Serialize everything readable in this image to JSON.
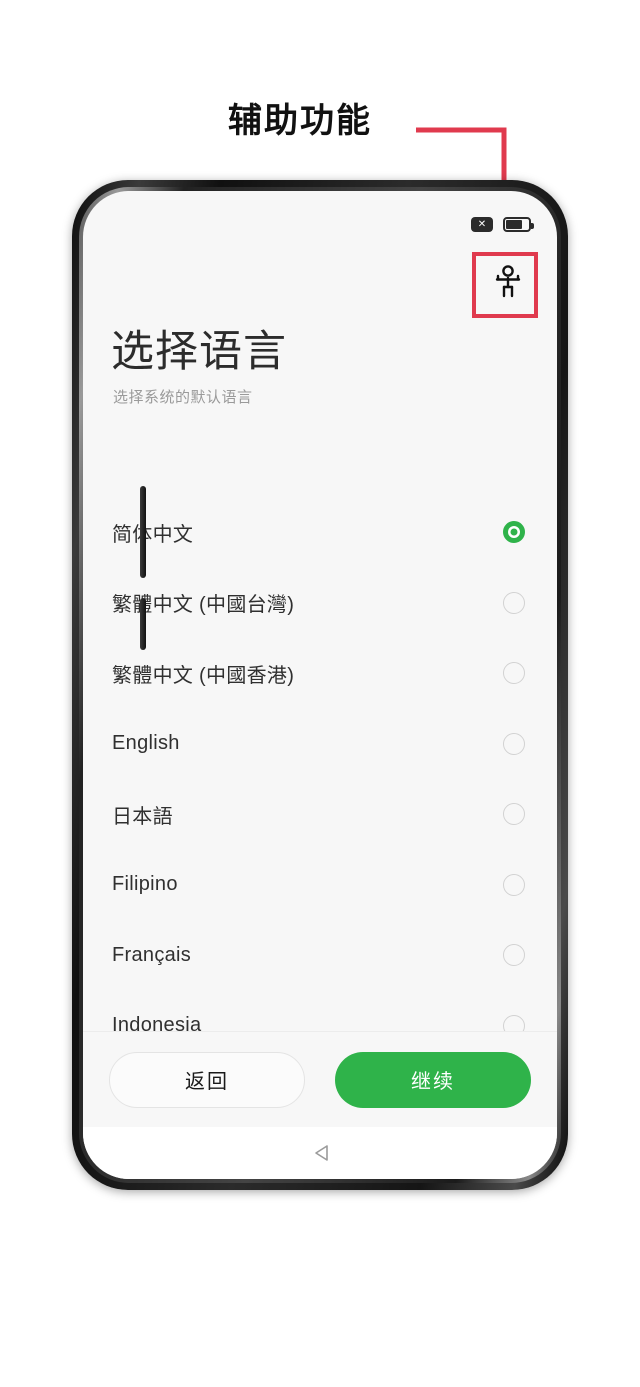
{
  "annotation": {
    "label": "辅助功能",
    "color": "#e03a4e"
  },
  "status_bar": {
    "mute_badge": "✕",
    "battery_icon": "battery-icon"
  },
  "accessibility_button": {
    "icon": "accessibility-icon"
  },
  "header": {
    "title": "选择语言",
    "subtitle": "选择系统的默认语言"
  },
  "languages": [
    {
      "label": "简体中文",
      "selected": true
    },
    {
      "label": "繁體中文 (中國台灣)",
      "selected": false
    },
    {
      "label": "繁體中文 (中國香港)",
      "selected": false
    },
    {
      "label": "English",
      "selected": false
    },
    {
      "label": "日本語",
      "selected": false
    },
    {
      "label": "Filipino",
      "selected": false
    },
    {
      "label": "Français",
      "selected": false
    },
    {
      "label": "Indonesia",
      "selected": false
    }
  ],
  "footer": {
    "back_label": "返回",
    "continue_label": "继续",
    "accent_color": "#2fb34a"
  },
  "nav_bar": {
    "back_icon": "back-triangle-icon"
  }
}
